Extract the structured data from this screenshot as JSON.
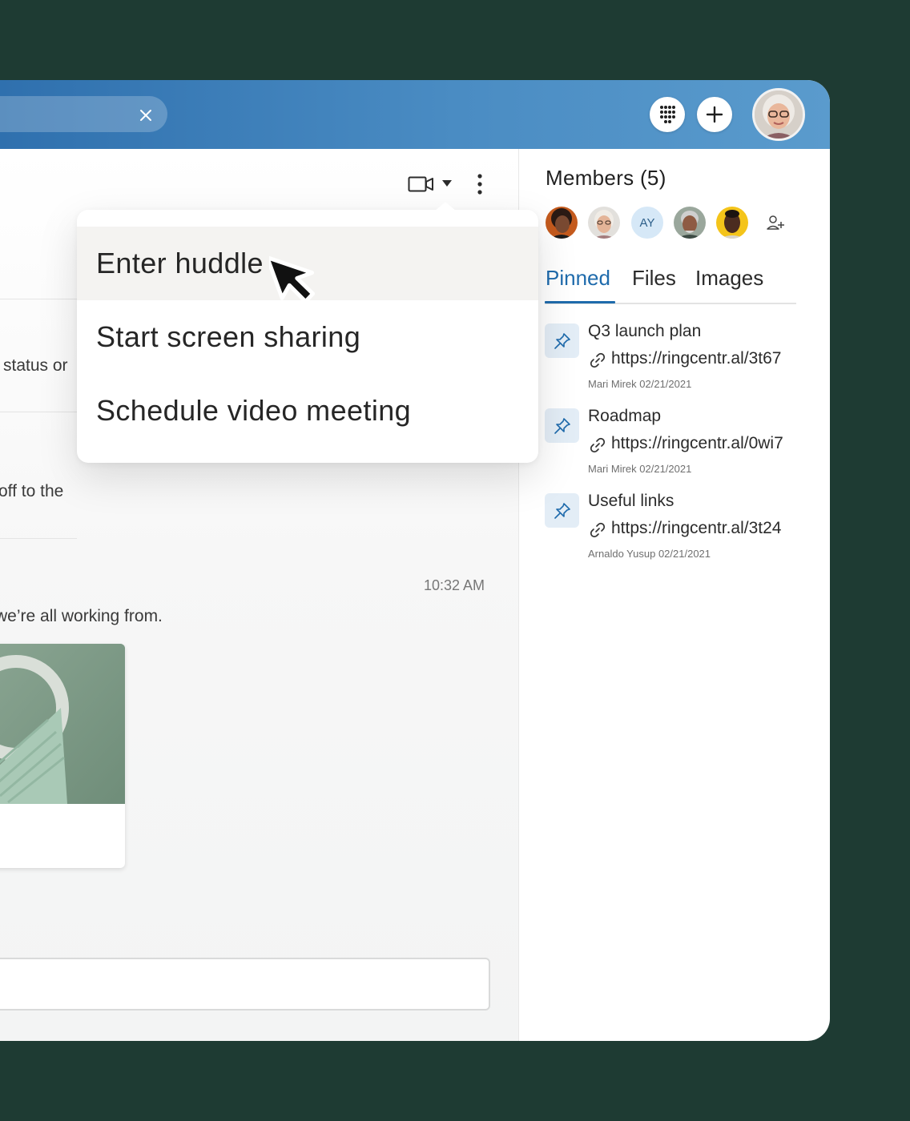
{
  "colors": {
    "background": "#1e3b33",
    "topbar": "#3f82bd",
    "accent": "#1f6bac",
    "pin_badge": "#e3edf6"
  },
  "topbar": {
    "search_clear_icon": "close-icon",
    "dialpad_icon": "dialpad-icon",
    "add_icon": "plus-icon",
    "user_avatar": "user-avatar"
  },
  "chat": {
    "fragments": {
      "line1": "status or",
      "line2": "off to the",
      "line3": "we’re all working from."
    },
    "timestamp": "10:32 AM"
  },
  "video_menu": {
    "items": [
      {
        "label": "Enter huddle",
        "hovered": true
      },
      {
        "label": "Start screen sharing",
        "hovered": false
      },
      {
        "label": "Schedule video meeting",
        "hovered": false
      }
    ]
  },
  "members": {
    "title": "Members (5)",
    "avatars": [
      "member-avatar-1",
      "member-avatar-2",
      "AY",
      "member-avatar-4",
      "member-avatar-5"
    ],
    "add_icon": "add-member-icon"
  },
  "tabs": [
    {
      "label": "Pinned",
      "active": true
    },
    {
      "label": "Files",
      "active": false
    },
    {
      "label": "Images",
      "active": false
    }
  ],
  "pinned": [
    {
      "title": "Q3 launch plan",
      "link": "https://ringcentr.al/3t67",
      "meta": "Mari Mirek 02/21/2021"
    },
    {
      "title": "Roadmap",
      "link": "https://ringcentr.al/0wi7",
      "meta": "Mari Mirek 02/21/2021"
    },
    {
      "title": "Useful links",
      "link": "https://ringcentr.al/3t24",
      "meta": "Arnaldo Yusup 02/21/2021"
    }
  ]
}
